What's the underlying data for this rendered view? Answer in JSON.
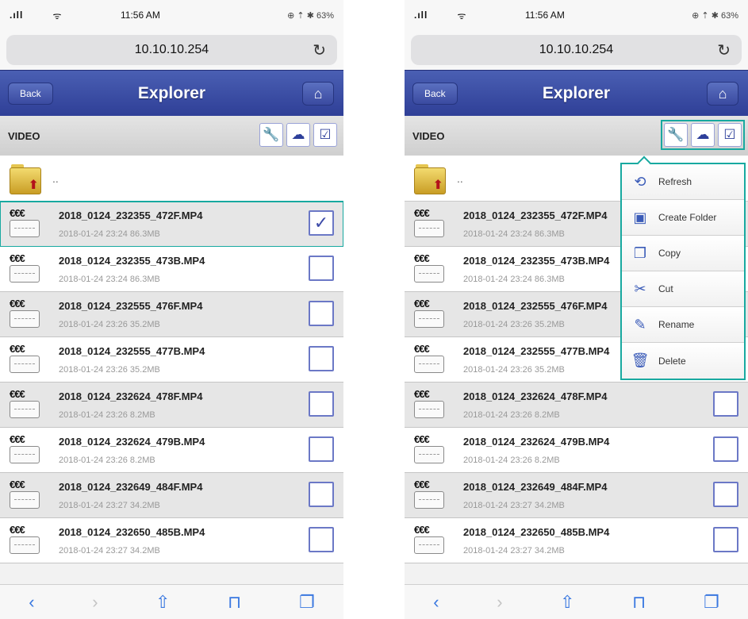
{
  "status": {
    "time": "11:56 AM",
    "right": "⊕ ⇡ ✱ 63%"
  },
  "url": "10.10.10.254",
  "nav": {
    "back": "Back",
    "title": "Explorer"
  },
  "section_label": "VIDEO",
  "parent_label": "..",
  "files": [
    {
      "name": "2018_0124_232355_472F.MP4",
      "meta": "2018-01-24 23:24  86.3MB",
      "checked": true
    },
    {
      "name": "2018_0124_232355_473B.MP4",
      "meta": "2018-01-24 23:24  86.3MB",
      "checked": false
    },
    {
      "name": "2018_0124_232555_476F.MP4",
      "meta": "2018-01-24 23:26  35.2MB",
      "checked": false
    },
    {
      "name": "2018_0124_232555_477B.MP4",
      "meta": "2018-01-24 23:26  35.2MB",
      "checked": false
    },
    {
      "name": "2018_0124_232624_478F.MP4",
      "meta": "2018-01-24 23:26  8.2MB",
      "checked": false
    },
    {
      "name": "2018_0124_232624_479B.MP4",
      "meta": "2018-01-24 23:26  8.2MB",
      "checked": false
    },
    {
      "name": "2018_0124_232649_484F.MP4",
      "meta": "2018-01-24 23:27  34.2MB",
      "checked": false
    },
    {
      "name": "2018_0124_232650_485B.MP4",
      "meta": "2018-01-24 23:27  34.2MB",
      "checked": false
    }
  ],
  "menu": [
    {
      "label": "Refresh",
      "icon": "refresh-icon"
    },
    {
      "label": "Create Folder",
      "icon": "create-folder-icon"
    },
    {
      "label": "Copy",
      "icon": "copy-icon"
    },
    {
      "label": "Cut",
      "icon": "cut-icon"
    },
    {
      "label": "Rename",
      "icon": "rename-icon"
    },
    {
      "label": "Delete",
      "icon": "delete-icon"
    }
  ],
  "colors": {
    "navbar": "#3a4aa0",
    "highlight": "#18a9a0",
    "checkbox": "#6b78c6"
  }
}
